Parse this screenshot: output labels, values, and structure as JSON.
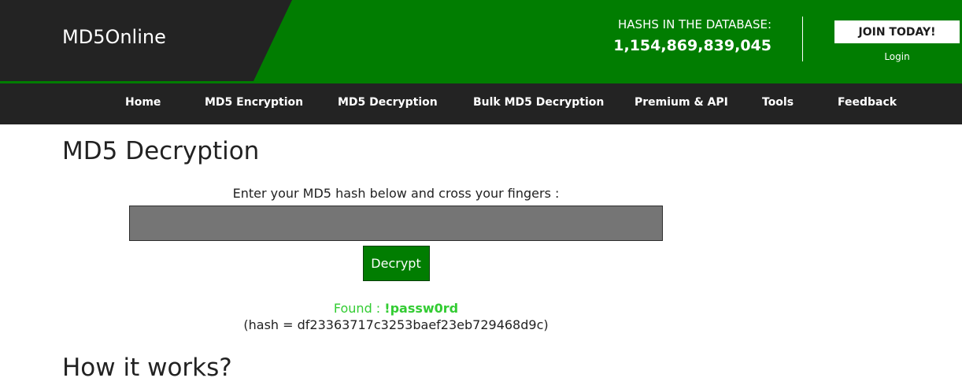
{
  "brand": {
    "logo": "MD5Online"
  },
  "header": {
    "hash_label": "HASHS IN THE DATABASE:",
    "hash_count": "1,154,869,839,045",
    "join_label": "JOIN TODAY!",
    "login_label": "Login"
  },
  "nav": {
    "items": [
      {
        "label": "Home"
      },
      {
        "label": "MD5 Encryption"
      },
      {
        "label": "MD5 Decryption"
      },
      {
        "label": "Bulk MD5 Decryption"
      },
      {
        "label": "Premium & API"
      },
      {
        "label": "Tools"
      },
      {
        "label": "Feedback"
      }
    ]
  },
  "main": {
    "title": "MD5 Decryption",
    "prompt": "Enter your MD5 hash below and cross your fingers :",
    "input_value": "",
    "decrypt_label": "Decrypt",
    "found_prefix": "Found : ",
    "found_value": "!passw0rd",
    "hash_line": "(hash = df23363717c3253baef23eb729468d9c)",
    "section_title": "How it works?"
  },
  "colors": {
    "brand_green": "#017d01",
    "dark": "#232323",
    "found_green": "#33cc33",
    "input_gray": "#757575"
  }
}
